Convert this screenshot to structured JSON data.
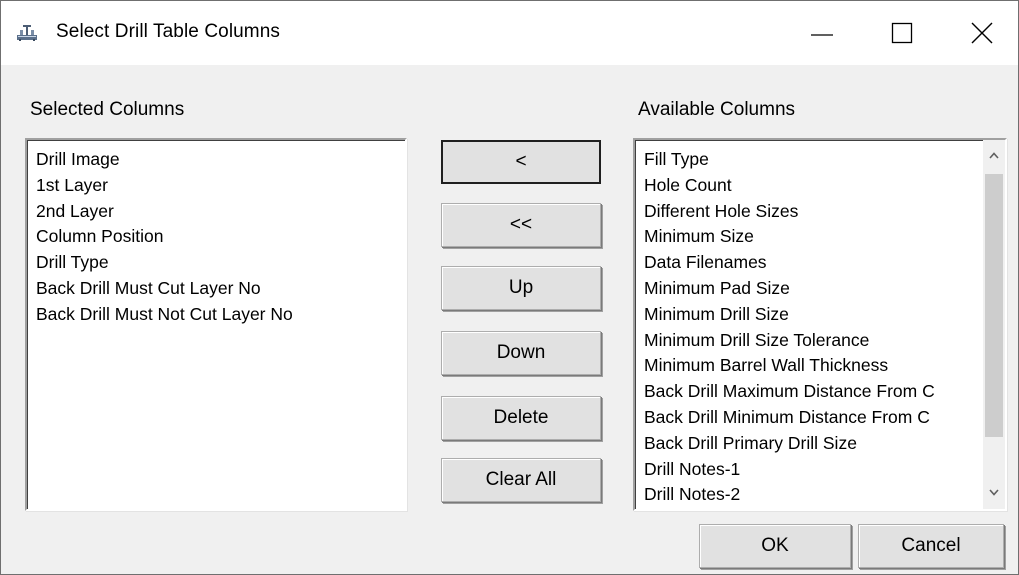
{
  "window": {
    "title": "Select Drill Table Columns",
    "icon": "drill-table-icon",
    "controls": [
      "minimize-icon",
      "maximize-icon",
      "close-icon"
    ]
  },
  "selected": {
    "label": "Selected Columns",
    "items": [
      "Drill Image",
      "1st Layer",
      "2nd Layer",
      "Column Position",
      "Drill Type",
      "Back Drill Must Cut Layer No",
      "Back Drill Must Not Cut Layer No"
    ]
  },
  "available": {
    "label": "Available Columns",
    "items": [
      "Fill Type",
      "Hole Count",
      "Different Hole Sizes",
      "Minimum Size",
      "Data Filenames",
      "Minimum Pad Size",
      "Minimum Drill Size",
      "Minimum Drill Size Tolerance",
      "Minimum Barrel Wall Thickness",
      "Back Drill Maximum Distance From C",
      "Back Drill Minimum Distance From C",
      "Back Drill Primary Drill Size",
      "Drill Notes-1",
      "Drill Notes-2"
    ]
  },
  "buttons": {
    "add": "<",
    "add_all": "<<",
    "up": "Up",
    "down": "Down",
    "delete": "Delete",
    "clear_all": "Clear All",
    "ok": "OK",
    "cancel": "Cancel"
  },
  "colors": {
    "dialog_bg": "#f0f0f0",
    "button_face": "#e1e1e1",
    "scroll_thumb": "#cdcdcd"
  }
}
